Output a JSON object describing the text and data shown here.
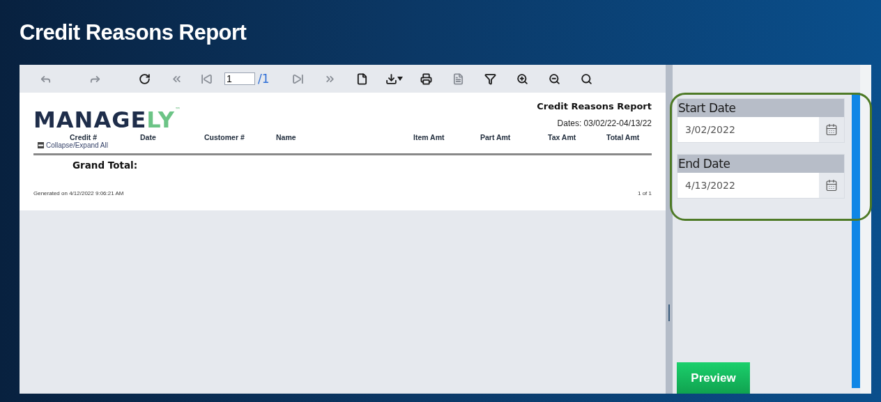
{
  "header": {
    "title": "Credit Reasons Report"
  },
  "toolbar": [
    {
      "kind": "back",
      "disabled": true
    },
    {
      "kind": "forward",
      "disabled": true
    },
    {
      "kind": "refresh",
      "disabled": false
    },
    {
      "kind": "first",
      "disabled": true
    },
    {
      "kind": "previous",
      "disabled": true
    },
    {
      "kind": "page",
      "value": "1",
      "total": "/1"
    },
    {
      "kind": "next",
      "disabled": true
    },
    {
      "kind": "last",
      "disabled": true
    },
    {
      "kind": "document",
      "disabled": false
    },
    {
      "kind": "export",
      "disabled": false
    },
    {
      "kind": "print",
      "disabled": false
    },
    {
      "kind": "notes",
      "disabled": true
    },
    {
      "kind": "filter",
      "disabled": false
    },
    {
      "kind": "zoom-in",
      "disabled": false
    },
    {
      "kind": "zoom-out",
      "disabled": false
    },
    {
      "kind": "search",
      "disabled": false
    }
  ],
  "report": {
    "logo": {
      "main": "MANAGE",
      "accent": "LY",
      "mark": "™"
    },
    "title": "Credit Reasons Report",
    "dates": "Dates: 03/02/22-04/13/22",
    "columns": [
      "Credit #",
      "Date",
      "Customer #",
      "Name",
      "Item Amt",
      "Part Amt",
      "Tax Amt",
      "Total Amt"
    ],
    "collapse": "Collapse/Expand All",
    "grand_total": "Grand Total:",
    "generated": "Generated on 4/12/2022 9:06:21 AM",
    "pages": "1 of 1"
  },
  "parameters": [
    {
      "label": "Start Date",
      "value": "3/02/2022"
    },
    {
      "label": "End Date",
      "value": "4/13/2022"
    }
  ],
  "preview_button": "Preview"
}
